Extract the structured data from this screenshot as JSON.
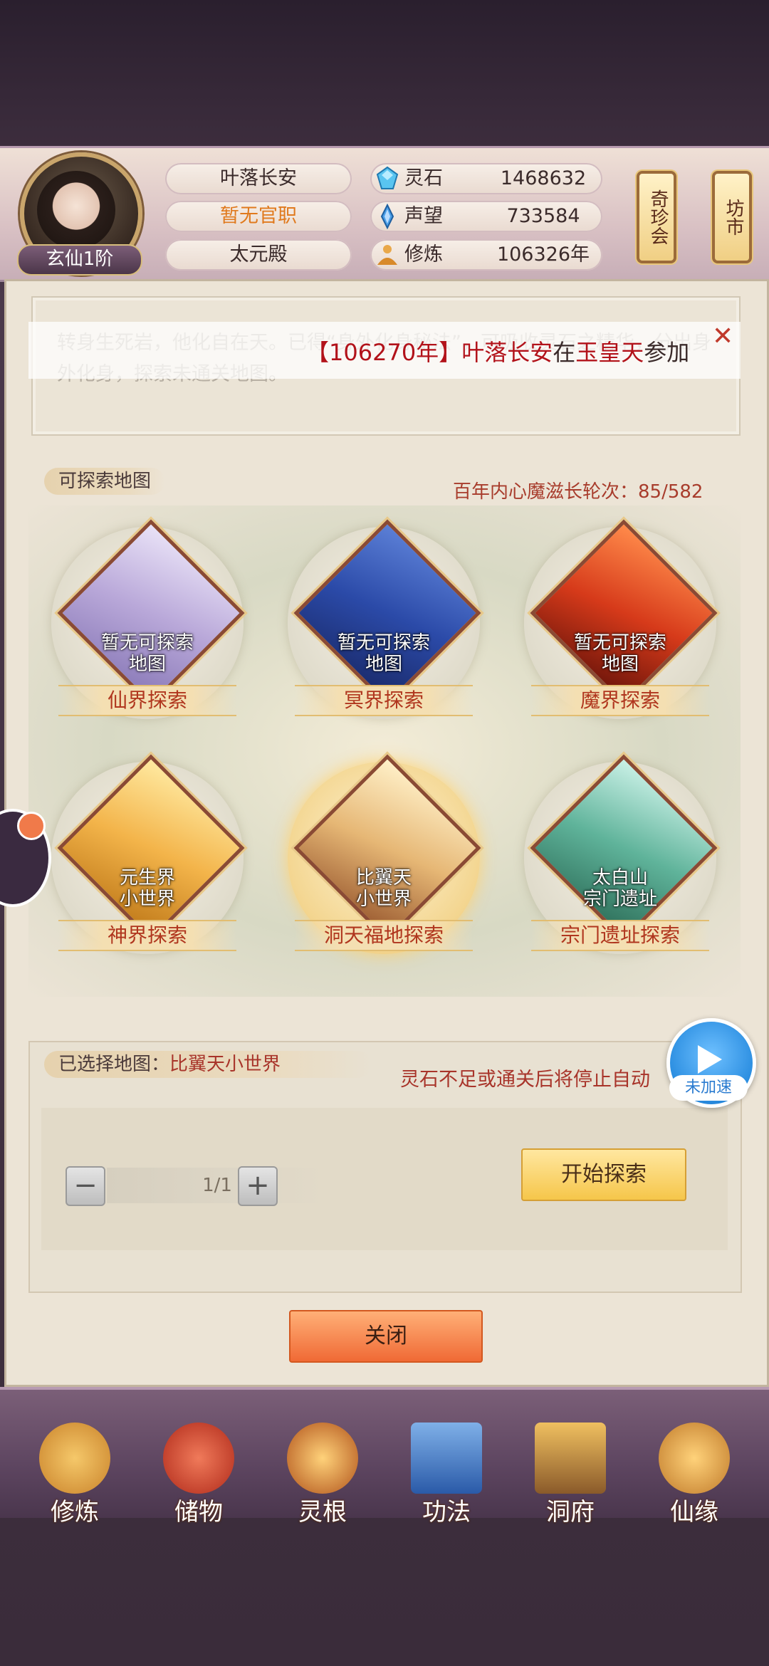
{
  "header": {
    "player_name": "叶落长安",
    "official_rank": "暂无官职",
    "sect_hall": "太元殿",
    "realm_badge": "玄仙1阶",
    "resources": [
      {
        "label": "灵石",
        "value": "1468632",
        "icon": "spirit-stone-icon"
      },
      {
        "label": "声望",
        "value": "733584",
        "icon": "prestige-icon"
      },
      {
        "label": "修炼",
        "value": "106326年",
        "icon": "cultivation-icon"
      }
    ],
    "side_buttons": {
      "treasure": "奇珍会",
      "market": "坊市"
    }
  },
  "log": {
    "faded_text": "转身生死岩，他化自在天。已得“身外化身秘法”，可吸收灵石之精华，分出身外化身，探索未通关地图。",
    "ticker_bracket_open": "【",
    "ticker_year": "106270年",
    "ticker_bracket_close": "】",
    "ticker_player": "叶落长安",
    "ticker_in": "在",
    "ticker_place": "玉皇天",
    "ticker_action": "参加"
  },
  "explore": {
    "section_title": "可探索地图",
    "demon_counter": "百年内心魔滋长轮次：85/582",
    "maps": [
      {
        "title": "仙界探索",
        "status_line1": "暂无可探索",
        "status_line2": "地图",
        "active": false
      },
      {
        "title": "冥界探索",
        "status_line1": "暂无可探索",
        "status_line2": "地图",
        "active": false
      },
      {
        "title": "魔界探索",
        "status_line1": "暂无可探索",
        "status_line2": "地图",
        "active": false
      },
      {
        "title": "神界探索",
        "status_line1": "元生界",
        "status_line2": "小世界",
        "active": false
      },
      {
        "title": "洞天福地探索",
        "status_line1": "比翼天",
        "status_line2": "小世界",
        "active": true
      },
      {
        "title": "宗门遗址探索",
        "status_line1": "太白山",
        "status_line2": "宗门遗址",
        "active": false
      }
    ]
  },
  "selection": {
    "label": "已选择地图：",
    "map_name": "比翼天小世界",
    "auto_note": "灵石不足或通关后将停止自动",
    "stepper_value": "1/1",
    "minus": "−",
    "plus": "+",
    "start_button": "开始探索",
    "speed_label": "未加速"
  },
  "close_button": "关闭",
  "bottom_nav": [
    {
      "label": "修炼",
      "icon": "meditation-icon"
    },
    {
      "label": "储物",
      "icon": "storage-bag-icon"
    },
    {
      "label": "灵根",
      "icon": "spirit-root-icon"
    },
    {
      "label": "功法",
      "icon": "scripture-book-icon"
    },
    {
      "label": "洞府",
      "icon": "cave-residence-icon"
    },
    {
      "label": "仙缘",
      "icon": "gourd-icon"
    }
  ],
  "colors": {
    "accent_red": "#a8342a",
    "ticker_red": "#b2121a",
    "gold_button": "#f6c64a",
    "close_button": "#f06a35",
    "speed_blue": "#2a8de0"
  }
}
